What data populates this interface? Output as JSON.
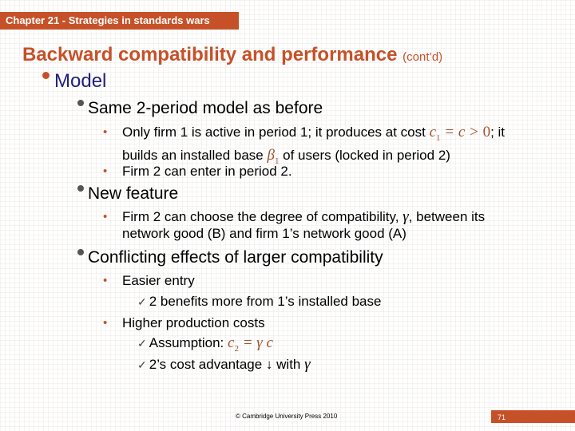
{
  "header": {
    "chapter": "Chapter 21 - Strategies in standards wars"
  },
  "slide": {
    "title": "Backward compatibility and performance",
    "title_suffix": "(cont’d)",
    "section": "Model",
    "points": [
      {
        "text": "Same 2-period model as before",
        "sub": [
          {
            "line1_pre": "Only firm 1 is active in period 1; it produces at cost ",
            "math_c1": "c",
            "math_c1_sub": "1",
            "math_rest": " = c > ",
            "math_zero": "0",
            "line1_post": "; it",
            "line2_pre": "builds an installed base ",
            "math_beta": "β",
            "math_beta_sub": "1",
            "line2_post": " of users (locked in period 2)"
          },
          {
            "text": "Firm 2 can enter in period 2."
          }
        ]
      },
      {
        "text": "New feature",
        "sub": [
          {
            "line1_pre": "Firm 2 can choose the degree of compatibility, ",
            "gamma": "γ",
            "line1_post": ", between its",
            "line2": "network good (B) and firm 1’s network good (A)"
          }
        ]
      },
      {
        "text": "Conflicting effects of larger compatibility",
        "sub": [
          {
            "text": "Easier entry",
            "checks": [
              {
                "text": "2 benefits more from 1’s installed base"
              }
            ]
          },
          {
            "text": "Higher production costs",
            "checks": [
              {
                "pre": "Assumption: ",
                "math_c": "c",
                "math_sub": "2",
                "math_rest": " = γ c"
              },
              {
                "pre": "2’s cost advantage ",
                "arrow": "↓",
                "mid": " with ",
                "gamma": "γ"
              }
            ]
          }
        ]
      }
    ]
  },
  "footer": {
    "copyright": "© Cambridge University Press 2010",
    "page_number": "71"
  },
  "colors": {
    "accent": "#c65128",
    "section_blue": "#1f1f7a",
    "math_brown": "#a0532a"
  }
}
